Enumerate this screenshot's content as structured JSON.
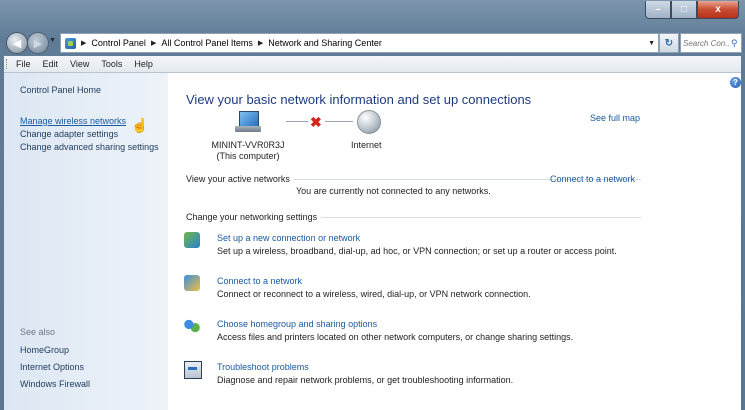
{
  "window": {
    "buttons": {
      "min": "–",
      "max": "□",
      "close": "x"
    }
  },
  "address": {
    "crumbs": [
      "Control Panel",
      "All Control Panel Items",
      "Network and Sharing Center"
    ],
    "search_placeholder": "Search Con..."
  },
  "menu": [
    "File",
    "Edit",
    "View",
    "Tools",
    "Help"
  ],
  "sidebar": {
    "home": "Control Panel Home",
    "links": [
      "Manage wireless networks",
      "Change adapter settings",
      "Change advanced sharing settings"
    ],
    "see_also_label": "See also",
    "see_also": [
      "HomeGroup",
      "Internet Options",
      "Windows Firewall"
    ]
  },
  "main": {
    "heading": "View your basic network information and set up connections",
    "see_full_map": "See full map",
    "computer_name": "MININT-VVR0R3J",
    "computer_sub": "(This computer)",
    "internet_label": "Internet",
    "active_networks_label": "View your active networks",
    "connect_link": "Connect to a network",
    "not_connected": "You are currently not connected to any networks.",
    "change_settings_label": "Change your networking settings",
    "tasks": [
      {
        "title": "Set up a new connection or network",
        "desc": "Set up a wireless, broadband, dial-up, ad hoc, or VPN connection; or set up a router or access point."
      },
      {
        "title": "Connect to a network",
        "desc": "Connect or reconnect to a wireless, wired, dial-up, or VPN network connection."
      },
      {
        "title": "Choose homegroup and sharing options",
        "desc": "Access files and printers located on other network computers, or change sharing settings."
      },
      {
        "title": "Troubleshoot problems",
        "desc": "Diagnose and repair network problems, or get troubleshooting information."
      }
    ]
  },
  "icons": {
    "help": "?",
    "refresh": "↻",
    "search": "⚲",
    "back": "◀",
    "forward": "▶",
    "dropdown": "▼",
    "crumb_sep": "▶",
    "disconnect": "✖",
    "pointer": "☝"
  }
}
